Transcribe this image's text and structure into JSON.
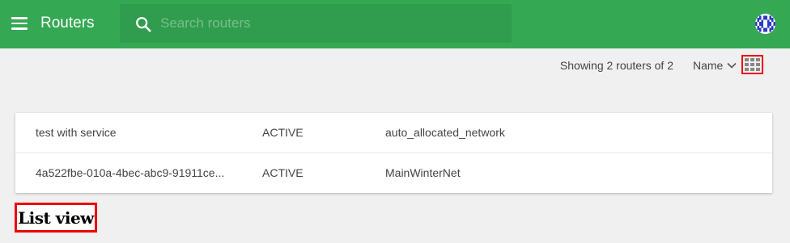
{
  "header": {
    "title": "Routers",
    "menu_icon": "hamburger-menu-icon",
    "search": {
      "placeholder": "Search routers",
      "value": "",
      "icon": "search-icon"
    },
    "avatar_icon": "identicon-avatar"
  },
  "toolbar": {
    "showing_text": "Showing 2 routers of 2",
    "sort_label": "Name",
    "sort_icon": "chevron-down-icon",
    "view_toggle_icon": "grid-view-icon"
  },
  "routers": [
    {
      "name": "test with service",
      "status": "ACTIVE",
      "network": "auto_allocated_network"
    },
    {
      "name": "4a522fbe-010a-4bec-abc9-91911ce...",
      "status": "ACTIVE",
      "network": "MainWinterNet"
    }
  ],
  "caption": "List view",
  "colors": {
    "appbar": "#34a853",
    "background": "#f0f0f0",
    "highlight": "#ee0000"
  }
}
